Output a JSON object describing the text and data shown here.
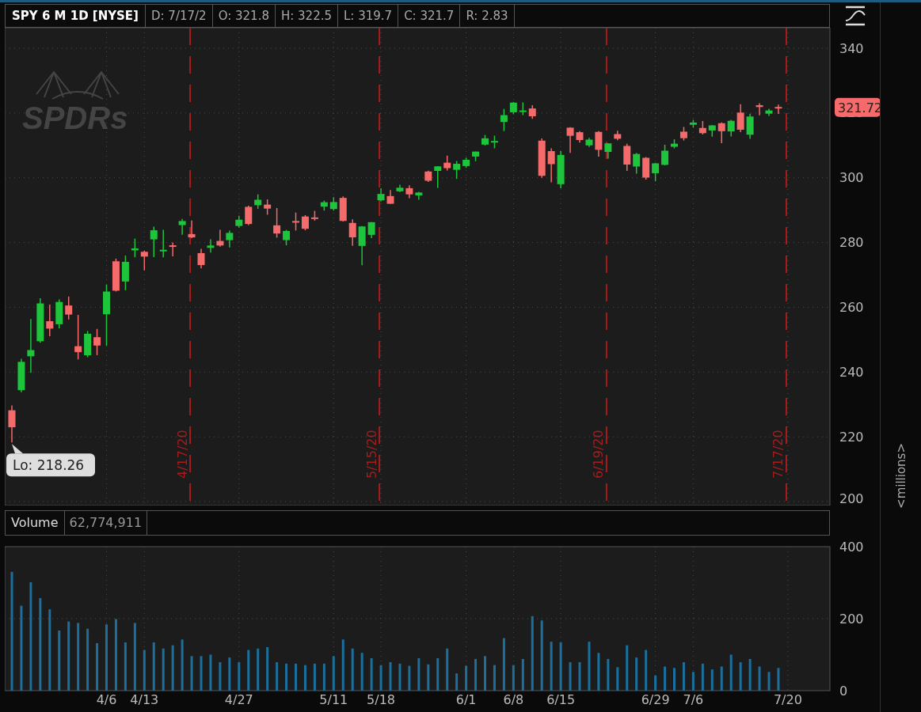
{
  "header": {
    "symbol": "SPY 6 M 1D [NYSE]",
    "fields": [
      "D: 7/17/2",
      "O: 321.8",
      "H: 322.5",
      "L: 319.7",
      "C: 321.7",
      "R: 2.83"
    ]
  },
  "logo": "SPDRs",
  "price_chart": {
    "last_price": "321.72",
    "low_label": "Lo: 218.26",
    "chart_data": {
      "type": "candlestick",
      "grid": true,
      "categories": [
        null,
        null,
        null,
        null,
        null,
        null,
        null,
        null,
        null,
        null,
        null,
        null,
        null,
        null,
        null,
        null,
        null,
        null,
        "4/17/20",
        null,
        null,
        null,
        null,
        null,
        null,
        null,
        null,
        null,
        null,
        null,
        null,
        null,
        null,
        null,
        null,
        null,
        null,
        null,
        "5/15/20",
        null,
        null,
        null,
        null,
        null,
        null,
        null,
        null,
        null,
        null,
        null,
        null,
        null,
        null,
        null,
        null,
        null,
        null,
        null,
        null,
        null,
        null,
        null,
        "6/19/20",
        null,
        null,
        null,
        null,
        null,
        null,
        null,
        null,
        null,
        null,
        null,
        null,
        null,
        null,
        null,
        null,
        null,
        null,
        "7/17/20"
      ],
      "ohlc": [
        [
          228.19,
          229.68,
          218.26,
          222.95
        ],
        [
          234.42,
          244.1,
          233.8,
          243.15
        ],
        [
          244.87,
          256.35,
          239.75,
          246.79
        ],
        [
          249.52,
          262.8,
          249.05,
          261.2
        ],
        [
          255.7,
          260.81,
          251.05,
          253.42
        ],
        [
          254.76,
          262.43,
          253.53,
          261.65
        ],
        [
          260.56,
          263.33,
          256.22,
          257.75
        ],
        [
          247.98,
          257.66,
          243.9,
          246.15
        ],
        [
          245.19,
          252.68,
          244.59,
          251.83
        ],
        [
          250.76,
          253.32,
          245.22,
          248.19
        ],
        [
          257.84,
          267,
          248.17,
          264.86
        ],
        [
          274.21,
          275.03,
          264.89,
          265.13
        ],
        [
          267.96,
          276,
          265.25,
          274.03
        ],
        [
          277.58,
          281.2,
          275.47,
          278.2
        ],
        [
          277.14,
          277.51,
          271.41,
          275.66
        ],
        [
          280.98,
          284.9,
          275.51,
          283.79
        ],
        [
          277.57,
          283.94,
          275.46,
          277.76
        ],
        [
          279.15,
          280.03,
          275.76,
          279.1
        ],
        [
          285.38,
          287.3,
          282.4,
          286.64
        ],
        [
          282.61,
          286.79,
          281.35,
          281.59
        ],
        [
          276.73,
          278.04,
          272.02,
          273.04
        ],
        [
          278.35,
          281,
          276.91,
          279.08
        ],
        [
          280.49,
          283.94,
          278.75,
          279.08
        ],
        [
          280.73,
          283.7,
          278.5,
          282.97
        ],
        [
          285.12,
          288.27,
          284.62,
          287.05
        ],
        [
          291.02,
          291.4,
          285.4,
          285.73
        ],
        [
          291.53,
          294.88,
          290.41,
          293.21
        ],
        [
          291.71,
          293.32,
          288.59,
          290.48
        ],
        [
          285.31,
          290.66,
          281.52,
          282.79
        ],
        [
          280.74,
          283.9,
          279.13,
          283.57
        ],
        [
          286.64,
          289.25,
          283.71,
          286.19
        ],
        [
          288.04,
          288.46,
          283.78,
          284.25
        ],
        [
          287.75,
          289.78,
          286.75,
          287.68
        ],
        [
          291.09,
          292.95,
          289.86,
          292.44
        ],
        [
          290.34,
          294,
          289.88,
          292.5
        ],
        [
          293.79,
          294.24,
          286.52,
          286.67
        ],
        [
          286.06,
          287.19,
          278.97,
          281.6
        ],
        [
          278.95,
          285.11,
          272.99,
          284.97
        ],
        [
          282.37,
          286.33,
          281.34,
          286.28
        ],
        [
          293.05,
          296.75,
          292.7,
          295
        ],
        [
          294.35,
          296.21,
          291.95,
          291.97
        ],
        [
          295.82,
          297.87,
          295.57,
          296.93
        ],
        [
          296.79,
          297.67,
          293.69,
          294.88
        ],
        [
          294.57,
          295.63,
          293.22,
          295.44
        ],
        [
          301.93,
          302.19,
          298.69,
          299.08
        ],
        [
          302.12,
          303.57,
          296.87,
          303.53
        ],
        [
          304.65,
          306.84,
          302.24,
          302.97
        ],
        [
          302.46,
          305.18,
          299.64,
          304.32
        ],
        [
          303.62,
          306.21,
          303.06,
          305.55
        ],
        [
          306.55,
          308.13,
          305.1,
          308.08
        ],
        [
          310.24,
          313.22,
          309.94,
          312.18
        ],
        [
          311.11,
          313,
          309.08,
          311.36
        ],
        [
          317.23,
          321.27,
          314.43,
          319.34
        ],
        [
          320.22,
          323.41,
          319.63,
          323.2
        ],
        [
          320.3,
          323.28,
          319.36,
          320.79
        ],
        [
          321.42,
          322.39,
          318.22,
          319
        ],
        [
          311.46,
          312.15,
          300.01,
          300.61
        ],
        [
          308.24,
          309.08,
          298.6,
          304.21
        ],
        [
          298.02,
          308.28,
          296.74,
          307.05
        ],
        [
          315.48,
          315.64,
          307.67,
          312.96
        ],
        [
          314.07,
          314.39,
          310.86,
          311.66
        ],
        [
          310.01,
          312.3,
          309.51,
          311.78
        ],
        [
          314.17,
          314.38,
          306.53,
          308.64
        ],
        [
          307.99,
          310.68,
          305.89,
          310.62
        ],
        [
          313.49,
          314.5,
          311.61,
          312.05
        ],
        [
          309.84,
          310.51,
          302.1,
          304.09
        ],
        [
          303.47,
          307.64,
          301.25,
          307.35
        ],
        [
          306.16,
          306.39,
          299.42,
          300.05
        ],
        [
          301.41,
          304.61,
          298.93,
          304.46
        ],
        [
          303.99,
          310.2,
          303.82,
          308.36
        ],
        [
          309.57,
          311.89,
          309.07,
          310.52
        ],
        [
          314.24,
          315.7,
          311.51,
          312.23
        ],
        [
          316.37,
          317.88,
          315.56,
          317.05
        ],
        [
          315.38,
          317.52,
          313.37,
          313.78
        ],
        [
          314.61,
          316.3,
          312.7,
          316.18
        ],
        [
          316.84,
          317.1,
          310.68,
          314.38
        ],
        [
          314.31,
          317.88,
          312.76,
          317.59
        ],
        [
          320.13,
          322.71,
          314.13,
          314.84
        ],
        [
          313.3,
          319.76,
          312,
          318.92
        ],
        [
          322.41,
          323.04,
          319.27,
          321.85
        ],
        [
          319.79,
          321.28,
          319.09,
          320.79
        ],
        [
          321.88,
          322.57,
          319.74,
          321.72
        ]
      ],
      "ylim": [
        200,
        340
      ],
      "yticks": [
        200,
        220,
        240,
        260,
        280,
        300,
        320,
        340
      ]
    }
  },
  "volume": {
    "value": "62,774,911",
    "axis_unit": "<millions>",
    "chart_data": {
      "type": "bar",
      "grid": true,
      "categories": [
        null,
        null,
        null,
        null,
        null,
        null,
        null,
        null,
        null,
        null,
        "4/6",
        null,
        null,
        null,
        "4/13",
        null,
        null,
        null,
        null,
        null,
        null,
        null,
        null,
        null,
        "4/27",
        null,
        null,
        null,
        null,
        null,
        null,
        null,
        null,
        null,
        "5/11",
        null,
        null,
        null,
        null,
        "5/18",
        null,
        null,
        null,
        null,
        null,
        null,
        null,
        null,
        "6/1",
        null,
        null,
        null,
        null,
        "6/8",
        null,
        null,
        null,
        null,
        "6/15",
        null,
        null,
        null,
        null,
        null,
        null,
        null,
        null,
        null,
        "6/29",
        null,
        null,
        null,
        "7/6",
        null,
        null,
        null,
        null,
        null,
        null,
        null,
        null,
        null,
        "7/20"
      ],
      "series": [
        {
          "name": "Volume",
          "color": "#1b6f9c",
          "values": [
            330,
            236,
            301,
            257,
            226,
            167,
            192,
            188,
            172,
            132,
            184,
            199,
            134,
            188,
            113,
            134,
            117,
            126,
            142,
            96,
            96,
            100,
            79,
            92,
            79,
            113,
            117,
            121,
            79,
            75,
            75,
            71,
            75,
            75,
            96,
            142,
            117,
            105,
            90,
            71,
            79,
            75,
            69,
            90,
            73,
            90,
            117,
            48,
            69,
            88,
            96,
            71,
            146,
            71,
            88,
            207,
            195,
            136,
            134,
            79,
            79,
            136,
            105,
            88,
            65,
            126,
            92,
            113,
            42,
            67,
            63,
            79,
            52,
            75,
            59,
            67,
            100,
            79,
            88,
            67,
            52,
            63,
            null
          ]
        }
      ],
      "ylim": [
        0,
        400
      ],
      "yticks": [
        0,
        200,
        400
      ]
    }
  }
}
